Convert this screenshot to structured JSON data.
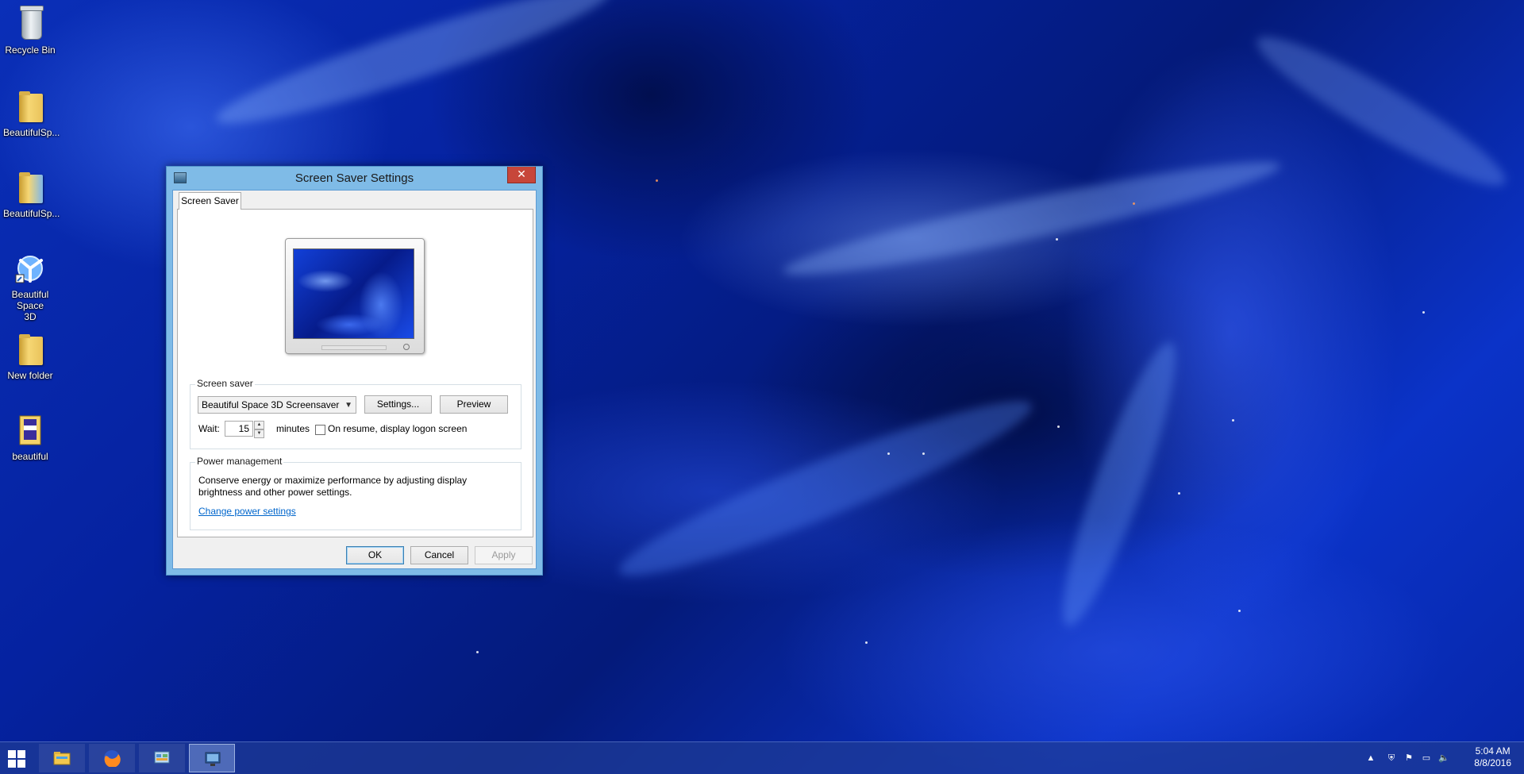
{
  "desktop": {
    "icons": [
      {
        "label": "Recycle Bin",
        "icon": "recycle-bin-icon"
      },
      {
        "label": "BeautifulSp...",
        "icon": "folder-icon"
      },
      {
        "label": "BeautifulSp...",
        "icon": "installer-folder-icon"
      },
      {
        "label": "Beautiful Space 3D",
        "icon": "beautiful-space-app-icon"
      },
      {
        "label": "New folder",
        "icon": "folder-icon"
      },
      {
        "label": "beautiful",
        "icon": "archive-icon"
      }
    ]
  },
  "dialog": {
    "title": "Screen Saver Settings",
    "close_label": "✕",
    "tab_label": "Screen Saver",
    "screen_saver": {
      "group_label": "Screen saver",
      "selected": "Beautiful Space 3D Screensaver",
      "settings_label": "Settings...",
      "preview_label": "Preview",
      "wait_label": "Wait:",
      "wait_value": "15",
      "minutes_label": "minutes",
      "resume_label": "On resume, display logon screen",
      "resume_checked": false
    },
    "power": {
      "group_label": "Power management",
      "description_line1": "Conserve energy or maximize performance by adjusting display",
      "description_line2": "brightness and other power settings.",
      "link_label": "Change power settings"
    },
    "buttons": {
      "ok": "OK",
      "cancel": "Cancel",
      "apply": "Apply"
    }
  },
  "taskbar": {
    "apps": [
      {
        "name": "file-explorer",
        "icon": "file-explorer-icon"
      },
      {
        "name": "firefox",
        "icon": "firefox-icon"
      },
      {
        "name": "control-panel",
        "icon": "control-panel-icon"
      },
      {
        "name": "screen-saver-settings",
        "icon": "screen-saver-icon"
      }
    ],
    "clock_time": "5:04 AM",
    "clock_date": "8/8/2016"
  },
  "colors": {
    "accent": "#7fbbe7",
    "close": "#c7463a",
    "link": "#0066cc"
  }
}
